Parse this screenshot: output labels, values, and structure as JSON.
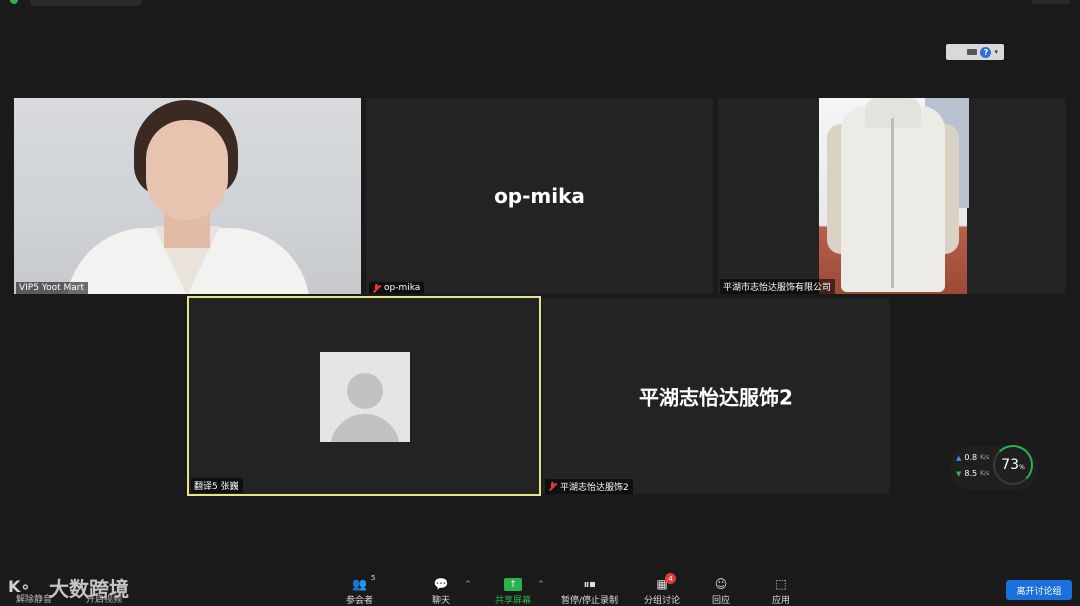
{
  "participants": [
    {
      "name": "VIP5 Yoot Mart",
      "muted": false
    },
    {
      "name": "op-mika",
      "display_name": "op-mika",
      "muted": true
    },
    {
      "name": "平湖市志怡达服饰有限公司",
      "muted": false
    },
    {
      "name": "翻译5 张巍",
      "muted": false,
      "active_speaker": true
    },
    {
      "name": "平湖志怡达服饰2",
      "display_name": "平湖志怡达服饰2",
      "muted": true
    }
  ],
  "network": {
    "upload": "0.8",
    "download": "8.5",
    "unit": "K/s",
    "cpu": "73",
    "cpu_unit": "%"
  },
  "toolbar": {
    "unmute_label": "解除静音",
    "start_video_label": "开启视频",
    "participants_label": "参会者",
    "participants_count": "5",
    "chat_label": "聊天",
    "share_label": "共享屏幕",
    "record_label": "暂停/停止录制",
    "breakout_label": "分组讨论",
    "breakout_badge": "4",
    "reactions_label": "回应",
    "apps_label": "应用",
    "leave_label": "离开讨论组"
  },
  "watermark": {
    "text": "大数跨境"
  },
  "colors": {
    "accent": "#2bb24c",
    "active_border": "#e8e28c",
    "leave": "#1a6fde",
    "mute": "#e23a3a"
  }
}
